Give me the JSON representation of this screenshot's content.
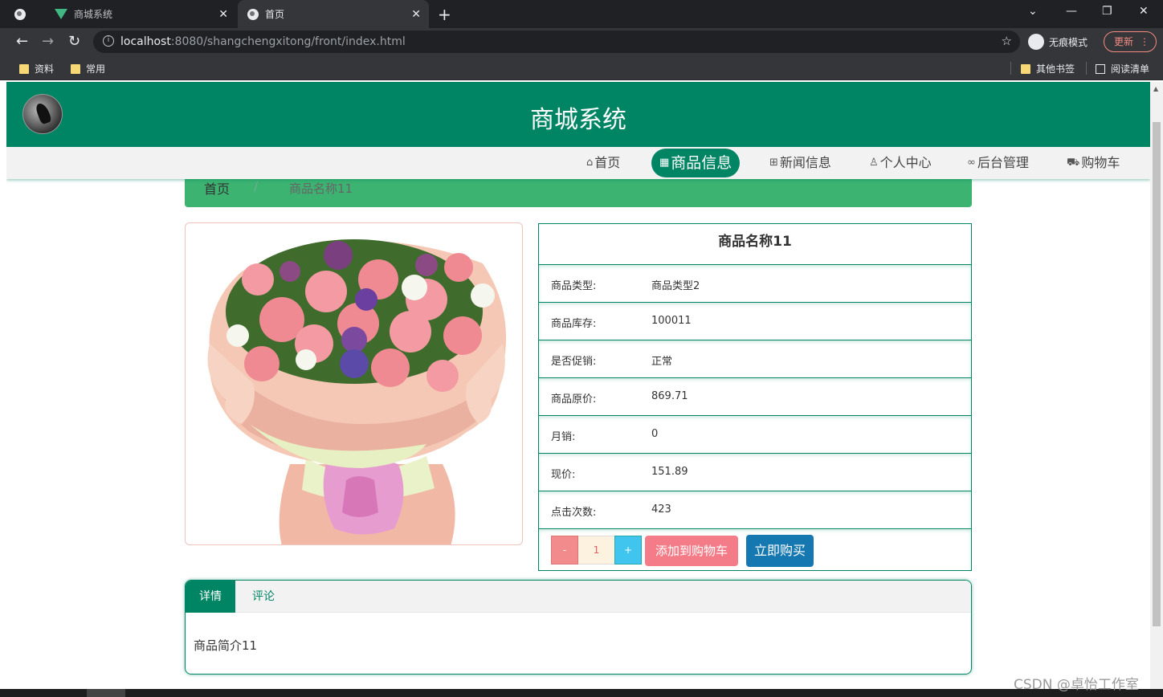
{
  "browser": {
    "tabs": [
      {
        "title": ""
      },
      {
        "title": "商城系统"
      },
      {
        "title": "首页"
      }
    ],
    "url_host": "localhost",
    "url_rest": ":8080/shangchengxitong/front/index.html",
    "incognito_label": "无痕模式",
    "update_label": "更新",
    "bookmarks": [
      "资料",
      "常用"
    ],
    "bookmarks_right": [
      "其他书签",
      "阅读清单"
    ]
  },
  "site": {
    "title": "商城系统",
    "nav": [
      {
        "label": "首页",
        "icon": "home-icon"
      },
      {
        "label": "商品信息",
        "icon": "grid-icon"
      },
      {
        "label": "新闻信息",
        "icon": "gift-icon"
      },
      {
        "label": "个人中心",
        "icon": "user-icon"
      },
      {
        "label": "后台管理",
        "icon": "link-icon"
      },
      {
        "label": "购物车",
        "icon": "cart-icon"
      }
    ],
    "active_nav": "商品信息"
  },
  "breadcrumb": {
    "home": "首页",
    "separator": "/",
    "current": "商品名称11"
  },
  "product": {
    "name": "商品名称11",
    "fields": [
      {
        "label": "商品类型:",
        "value": "商品类型2"
      },
      {
        "label": "商品库存:",
        "value": "100011"
      },
      {
        "label": "是否促销:",
        "value": "正常"
      },
      {
        "label": "商品原价:",
        "value": "869.71"
      },
      {
        "label": "月销:",
        "value": "0"
      },
      {
        "label": "现价:",
        "value": "151.89"
      },
      {
        "label": "点击次数:",
        "value": "423"
      }
    ],
    "quantity": "1",
    "minus_label": "-",
    "plus_label": "+",
    "add_to_cart_label": "添加到购物车",
    "buy_now_label": "立即购买"
  },
  "detail_tabs": {
    "tabs": [
      "详情",
      "评论"
    ],
    "active": "详情",
    "content": "商品简介11"
  },
  "watermark": "CSDN @卓怡工作室",
  "colors": {
    "header_green": "#008564",
    "breadcrumb_green": "#3cb371",
    "cart_button": "#f47c88",
    "buy_button": "#1678b0"
  }
}
